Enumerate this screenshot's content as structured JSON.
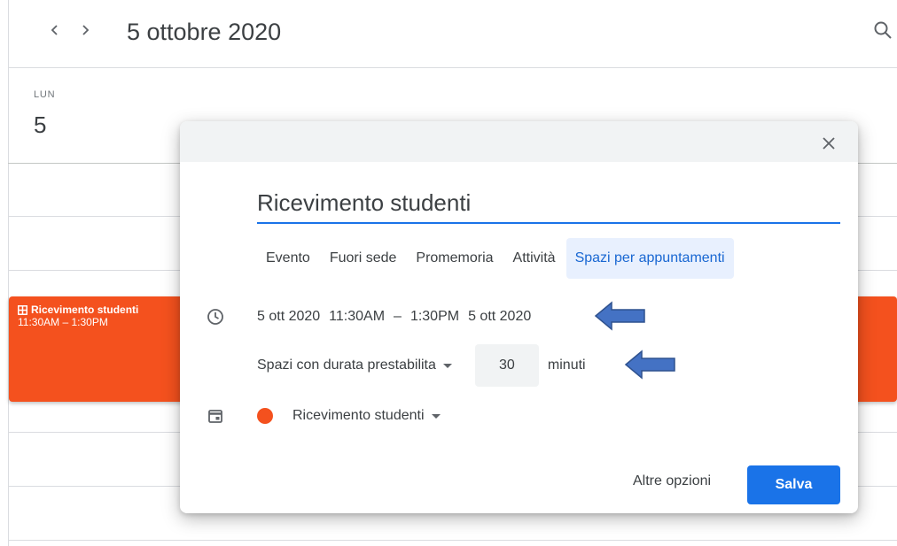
{
  "header": {
    "date_title": "5 ottobre 2020",
    "prev_icon": "chevron-left-icon",
    "next_icon": "chevron-right-icon",
    "search_icon": "search-icon"
  },
  "day_column": {
    "day_name": "LUN",
    "day_number": "5"
  },
  "calendar_event": {
    "title": "Ricevimento studenti",
    "time": "11:30AM – 1:30PM",
    "icon": "appointment-grid-icon",
    "color": "#f4511e"
  },
  "dialog": {
    "title_value": "Ricevimento studenti",
    "tabs": [
      {
        "label": "Evento"
      },
      {
        "label": "Fuori sede"
      },
      {
        "label": "Promemoria"
      },
      {
        "label": "Attività"
      },
      {
        "label": "Spazi per appuntamenti",
        "active": true
      }
    ],
    "datetime": {
      "start_date": "5 ott 2020",
      "start_time": "11:30AM",
      "separator": "–",
      "end_time": "1:30PM",
      "end_date": "5 ott 2020"
    },
    "slots": {
      "mode_label": "Spazi con durata prestabilita",
      "duration_value": "30",
      "unit": "minuti"
    },
    "calendar": {
      "name": "Ricevimento studenti",
      "color": "#f4511e"
    },
    "more_options_label": "Altre opzioni",
    "save_label": "Salva"
  },
  "colors": {
    "accent": "#1a73e8",
    "event": "#f4511e",
    "annotation_arrow": "#4472c4"
  }
}
